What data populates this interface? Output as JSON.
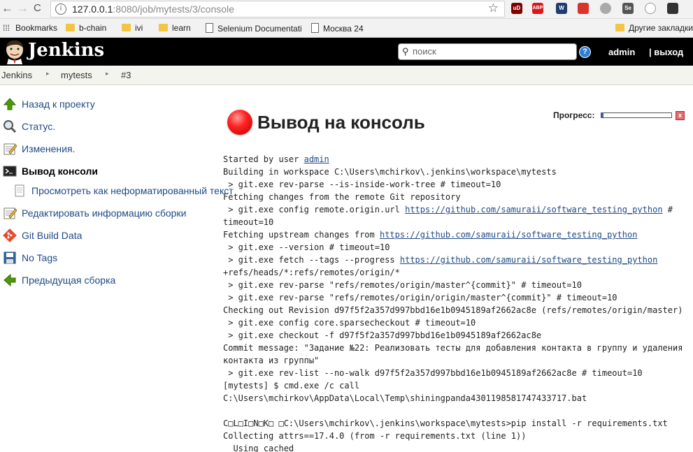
{
  "browser": {
    "url_host": "127.0.0.1",
    "url_rest": ":8080/job/mytests/3/console",
    "back": "←",
    "forward": "→",
    "reload": "C",
    "info": "i",
    "star": "☆",
    "extensions": [
      "uD",
      "ABP",
      "W",
      "",
      "",
      "Se",
      "",
      ""
    ],
    "bookmarks": [
      "Bookmarks",
      "b-chain",
      "ivi",
      "learn",
      "Selenium Documentati",
      "Москва 24",
      "Другие закладки"
    ]
  },
  "header": {
    "brand": "Jenkins",
    "search_placeholder": "поиск",
    "help": "?",
    "user": "admin",
    "logout": "| выход"
  },
  "breadcrumbs": [
    "Jenkins",
    "mytests",
    "#3"
  ],
  "breadcrumb_sep": "▸",
  "tasks": [
    {
      "label": "Назад к проекту",
      "icon": "up-arrow-icon"
    },
    {
      "label": "Статус.",
      "icon": "magnifier-icon"
    },
    {
      "label": "Изменения.",
      "icon": "notepad-icon"
    },
    {
      "label": "Вывод консоли",
      "icon": "terminal-icon"
    },
    {
      "label": "Просмотреть как неформатированный текст",
      "icon": "document-icon"
    },
    {
      "label": "Редактировать информацию сборки",
      "icon": "notepad-icon"
    },
    {
      "label": "Git Build Data",
      "icon": "git-icon"
    },
    {
      "label": "No Tags",
      "icon": "save-icon"
    },
    {
      "label": "Предыдущая сборка",
      "icon": "left-arrow-icon"
    }
  ],
  "main": {
    "title": "Вывод на консоль",
    "status_color": "#e22222",
    "progress_label": "Прогресс:",
    "progress_fraction": 0.03,
    "stop": "x"
  },
  "console": {
    "started_prefix": "Started by user ",
    "started_user": "admin",
    "l2": "Building in workspace C:\\Users\\mchirkov\\.jenkins\\workspace\\mytests",
    "l3": " > git.exe rev-parse --is-inside-work-tree # timeout=10",
    "l4": "Fetching changes from the remote Git repository",
    "l5_prefix": " > git.exe config remote.origin.url ",
    "repo_url": "https://github.com/samuraii/software_testing_python",
    "l5_suffix": " #",
    "l6": "timeout=10",
    "l7_prefix": "Fetching upstream changes from ",
    "l8": " > git.exe --version # timeout=10",
    "l9_prefix": " > git.exe fetch --tags --progress ",
    "l10": "+refs/heads/*:refs/remotes/origin/*",
    "l11": " > git.exe rev-parse \"refs/remotes/origin/master^{commit}\" # timeout=10",
    "l12": " > git.exe rev-parse \"refs/remotes/origin/origin/master^{commit}\" # timeout=10",
    "l13": "Checking out Revision d97f5f2a357d997bbd16e1b0945189af2662ac8e (refs/remotes/origin/master)",
    "l14": " > git.exe config core.sparsecheckout # timeout=10",
    "l15": " > git.exe checkout -f d97f5f2a357d997bbd16e1b0945189af2662ac8e",
    "l16": "Commit message: \"Задание №22: Реализовать тесты для добавления контакта в группу и удаления",
    "l17": "контакта из группы\"",
    "l18": " > git.exe rev-list --no-walk d97f5f2a357d997bbd16e1b0945189af2662ac8e # timeout=10",
    "l19": "[mytests] $ cmd.exe /c call",
    "l20": "C:\\Users\\mchirkov\\AppData\\Local\\Temp\\shiningpanda4301198581747433717.bat",
    "l21": "",
    "l22": "C□L□I□N□K□ □C:\\Users\\mchirkov\\.jenkins\\workspace\\mytests>pip install -r requirements.txt",
    "l23": "Collecting attrs==17.4.0 (from -r requirements.txt (line 1))",
    "l24": "  Using cached"
  }
}
